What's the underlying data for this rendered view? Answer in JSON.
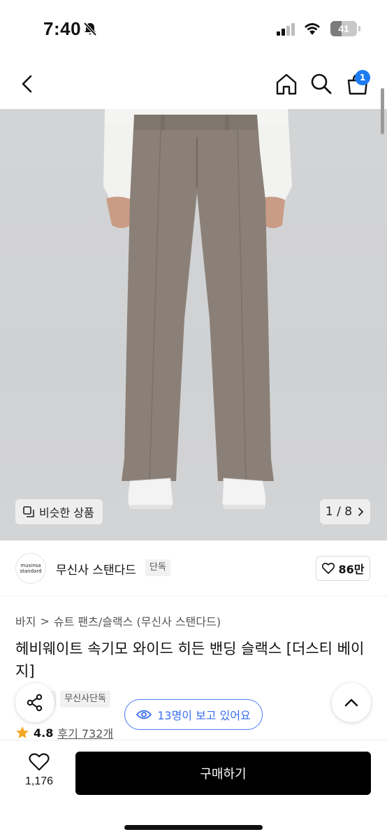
{
  "status_bar": {
    "time": "7:40",
    "battery_level": "41",
    "battery_fraction": 0.41,
    "icons": [
      "bell-slash-icon",
      "signal-icon",
      "wifi-icon",
      "battery-icon"
    ]
  },
  "nav": {
    "icons": [
      "back-icon",
      "home-icon",
      "search-icon",
      "cart-icon"
    ],
    "cart_badge": "1"
  },
  "gallery": {
    "similar_label": "비슷한 상품",
    "counter": "1 / 8",
    "background_color": "#d2d3d5",
    "pants_color": "#8a8077"
  },
  "brand": {
    "logo_line1": "musinsa",
    "logo_line2": "standard",
    "name": "무신사 스탠다드",
    "tag": "단독",
    "likes": "86만"
  },
  "breadcrumb": {
    "root": "바지",
    "separator": ">",
    "category": "슈트 팬츠/슬랙스 (무신사 스탠다드)"
  },
  "product": {
    "title": "헤비웨이트 속기모 와이드 히든 밴딩 슬랙스 [더스티 베이지]",
    "tags": [
      "송",
      "무신사단독"
    ],
    "rating": "4.8",
    "review_label": "후기 732개"
  },
  "floating": {
    "viewers_text": "13명이 보고 있어요",
    "accent_color": "#3b6ff0"
  },
  "bottom_bar": {
    "wish_count": "1,176",
    "buy_label": "구매하기"
  }
}
